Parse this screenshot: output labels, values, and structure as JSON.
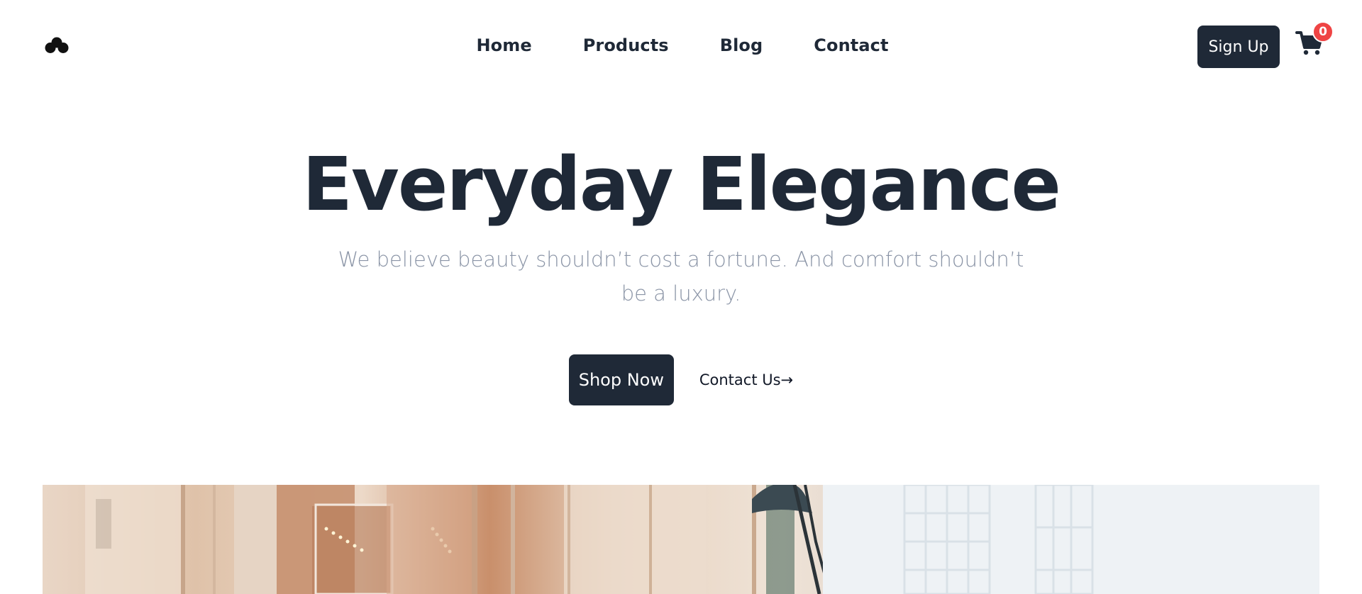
{
  "nav": {
    "links": [
      "Home",
      "Products",
      "Blog",
      "Contact"
    ]
  },
  "header": {
    "signup_label": "Sign Up",
    "cart_count": "0"
  },
  "hero": {
    "title": "Everyday Elegance",
    "subtitle": "We believe beauty shouldn’t cost a fortune. And comfort shouldn’t be a luxury.",
    "shop_label": "Shop Now",
    "contact_label": "Contact Us→"
  },
  "icons": {
    "logo": "three-circles-logo-icon",
    "cart": "shopping-cart-icon"
  },
  "colors": {
    "primary": "#1f2937",
    "muted_text": "#8a94a6",
    "badge": "#ef4444",
    "background": "#ffffff"
  }
}
